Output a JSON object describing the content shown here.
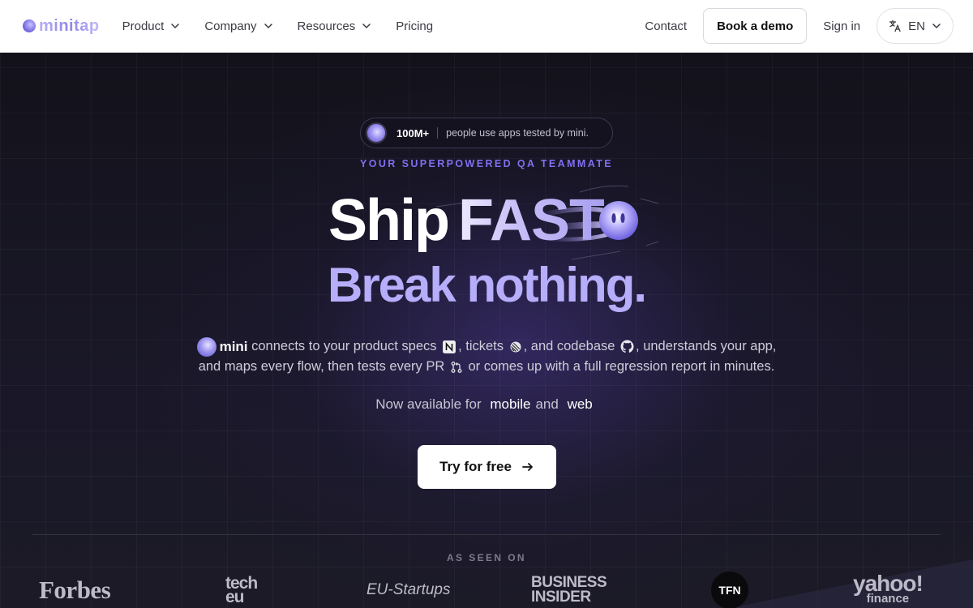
{
  "nav": {
    "logo_text": "minitap",
    "items": [
      {
        "label": "Product",
        "dropdown": true
      },
      {
        "label": "Company",
        "dropdown": true
      },
      {
        "label": "Resources",
        "dropdown": true
      },
      {
        "label": "Pricing",
        "dropdown": false
      }
    ],
    "contact": "Contact",
    "demo": "Book a demo",
    "signin": "Sign in",
    "language": "EN"
  },
  "hero": {
    "pill_count": "100M+",
    "pill_text": "people use apps tested by mini.",
    "eyebrow": "YOUR SUPERPOWERED QA TEAMMATE",
    "headline_1": "Ship",
    "headline_2": "FAST",
    "headline_3": "Break nothing.",
    "desc": {
      "mini": "mini",
      "part1": " connects to your product specs ",
      "part2": ", tickets ",
      "part3": ", and codebase ",
      "part4": ", understands your app,",
      "part5": "and maps every flow, then tests every PR ",
      "part6": " or comes up with a full regression report in minutes."
    },
    "avail_prefix": "Now available for",
    "avail_a": "mobile",
    "avail_and": "and",
    "avail_b": "web",
    "cta": "Try for free"
  },
  "press": {
    "heading": "AS SEEN ON",
    "forbes": "Forbes",
    "techeu_1": "tech",
    "techeu_2": "eu",
    "eustartups": "EU-Startups",
    "bi_1": "BUSINESS",
    "bi_2": "INSIDER",
    "tfn": "TFN",
    "yahoo_1": "yahoo!",
    "yahoo_2": "finance"
  },
  "colors": {
    "accent": "#7f6ff0",
    "headline_sub": "#b6adfb",
    "hero_bg": "#16141f"
  },
  "icons": [
    "chevron-down-icon",
    "translate-icon",
    "notion-icon",
    "linear-icon",
    "github-icon",
    "pull-request-icon",
    "arrow-right-icon",
    "comet-icon"
  ]
}
